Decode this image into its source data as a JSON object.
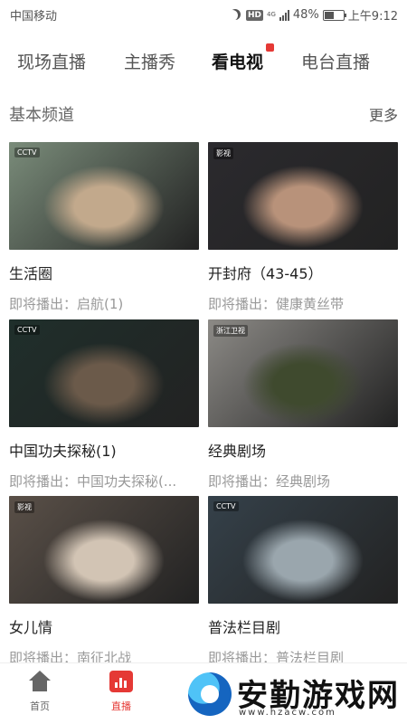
{
  "status_bar": {
    "carrier": "中国移动",
    "hd_badge": "HD",
    "network": "4G",
    "battery_percent": "48%",
    "battery_level": 0.48,
    "time": "上午9:12",
    "icons": [
      "moon-icon",
      "hd-icon",
      "signal-icon",
      "battery-icon"
    ]
  },
  "tabs": [
    {
      "label": "现场直播",
      "active": false
    },
    {
      "label": "主播秀",
      "active": false
    },
    {
      "label": "看电视",
      "active": true,
      "badge_color": "#e53935"
    },
    {
      "label": "电台直播",
      "active": false
    }
  ],
  "section": {
    "title": "基本频道",
    "more": "更多"
  },
  "channels": [
    {
      "title": "生活圈",
      "next": "即将播出：启航(1)",
      "thumb_bg": "#7a8c7a",
      "thumb_fg": "#c2a98c",
      "logo": "CCTV"
    },
    {
      "title": "开封府（43-45）",
      "next": "即将播出：健康黄丝带",
      "thumb_bg": "#2b2a2e",
      "thumb_fg": "#b8927a",
      "logo": "影视"
    },
    {
      "title": "中国功夫探秘(1)",
      "next": "即将播出：中国功夫探秘(...",
      "thumb_bg": "#1f2f2b",
      "thumb_fg": "#6b5a4a",
      "logo": "CCTV"
    },
    {
      "title": "经典剧场",
      "next": "即将播出：经典剧场",
      "thumb_bg": "#8c8a86",
      "thumb_fg": "#3f4a2e",
      "logo": "浙江卫视"
    },
    {
      "title": "女儿情",
      "next": "即将播出：南征北战",
      "thumb_bg": "#5a5048",
      "thumb_fg": "#d2c4b4",
      "logo": "影视"
    },
    {
      "title": "普法栏目剧",
      "next": "即将播出：普法栏目剧",
      "thumb_bg": "#35414a",
      "thumb_fg": "#9aa6ad",
      "logo": "CCTV"
    }
  ],
  "bottom_nav": [
    {
      "label": "首页",
      "icon": "home-icon",
      "active": false
    },
    {
      "label": "直播",
      "icon": "live-icon",
      "active": true
    }
  ],
  "watermark": {
    "text": "安勤游戏网",
    "url": "www.hzacw.com"
  },
  "colors": {
    "accent": "#e53935",
    "text_primary": "#222222",
    "text_secondary": "#999999"
  }
}
